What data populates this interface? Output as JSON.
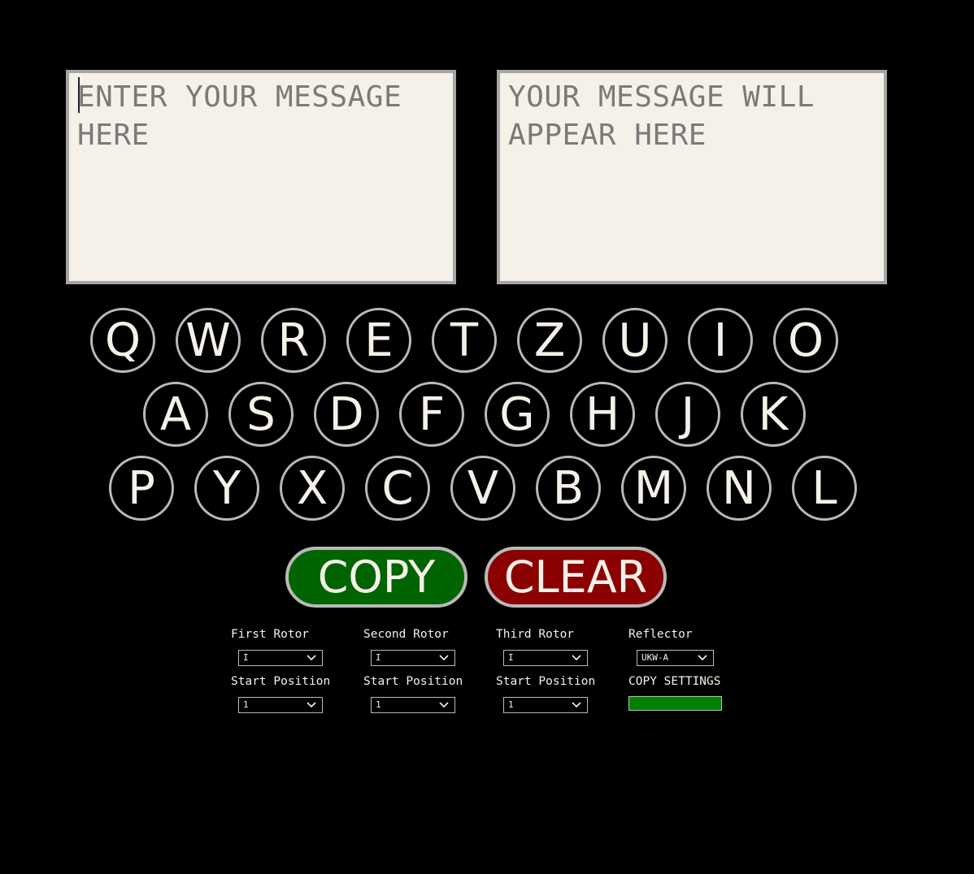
{
  "input": {
    "placeholder": "ENTER YOUR MESSAGE HERE",
    "value": ""
  },
  "output": {
    "placeholder": "YOUR MESSAGE WILL APPEAR HERE",
    "value": ""
  },
  "keyboard": {
    "row1": [
      "Q",
      "W",
      "R",
      "E",
      "T",
      "Z",
      "U",
      "I",
      "O"
    ],
    "row2": [
      "A",
      "S",
      "D",
      "F",
      "G",
      "H",
      "J",
      "K"
    ],
    "row3": [
      "P",
      "Y",
      "X",
      "C",
      "V",
      "B",
      "M",
      "N",
      "L"
    ]
  },
  "buttons": {
    "copy_label": "COPY",
    "clear_label": "CLEAR"
  },
  "settings": {
    "first_rotor_label": "First Rotor",
    "first_rotor_value": "I",
    "second_rotor_label": "Second Rotor",
    "second_rotor_value": "I",
    "third_rotor_label": "Third Rotor",
    "third_rotor_value": "I",
    "reflector_label": "Reflector",
    "reflector_value": "UKW-A",
    "first_start_label": "Start Position",
    "first_start_value": "1",
    "second_start_label": "Start Position",
    "second_start_value": "1",
    "third_start_label": "Start Position",
    "third_start_value": "1",
    "copy_settings_label": "COPY SETTINGS"
  },
  "colors": {
    "background": "#000000",
    "textbox_bg": "#f5f1e8",
    "copy_green": "#006400",
    "clear_red": "#8b0000",
    "copy_settings_green": "#008000",
    "key_border": "#b9b9b9"
  },
  "icons": {
    "select_arrow": "chevron-down-icon"
  }
}
